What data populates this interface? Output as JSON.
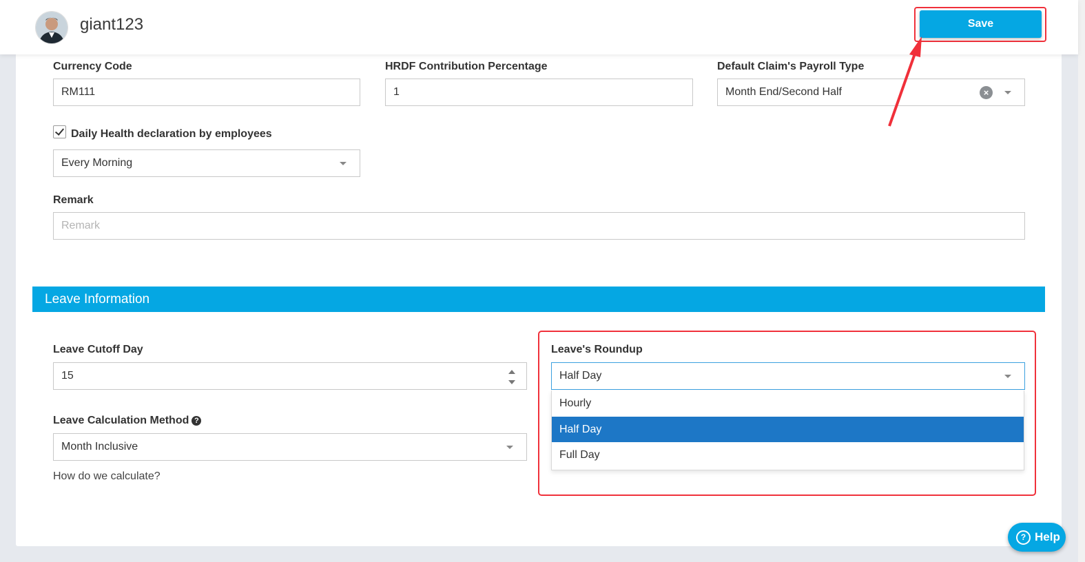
{
  "header": {
    "username": "giant123",
    "save_label": "Save"
  },
  "fields": {
    "currency_code": {
      "label": "Currency Code",
      "value": "RM111"
    },
    "hrdf": {
      "label": "HRDF Contribution Percentage",
      "value": "1"
    },
    "payroll_type": {
      "label": "Default Claim's Payroll Type",
      "value": "Month End/Second Half"
    },
    "health": {
      "label": "Daily Health declaration by employees",
      "checked": true,
      "value": "Every Morning"
    },
    "remark": {
      "label": "Remark",
      "placeholder": "Remark",
      "value": ""
    }
  },
  "leave": {
    "section_title": "Leave Information",
    "cutoff": {
      "label": "Leave Cutoff Day",
      "value": "15"
    },
    "method": {
      "label": "Leave Calculation Method",
      "value": "Month Inclusive",
      "help_text": "How do we calculate?"
    },
    "roundup": {
      "label": "Leave's Roundup",
      "value": "Half Day",
      "options": [
        "Hourly",
        "Half Day",
        "Full Day"
      ],
      "selected_index": 1
    }
  },
  "help_button": {
    "label": "Help"
  },
  "colors": {
    "accent": "#05a7e3",
    "selected_option": "#1d77c6",
    "highlight": "#f0303a"
  },
  "icons": [
    "avatar",
    "clear-icon",
    "caret-down-icon",
    "checkmark-icon",
    "question-circle-icon",
    "spinner-up-icon",
    "spinner-down-icon",
    "annotation-arrow"
  ]
}
